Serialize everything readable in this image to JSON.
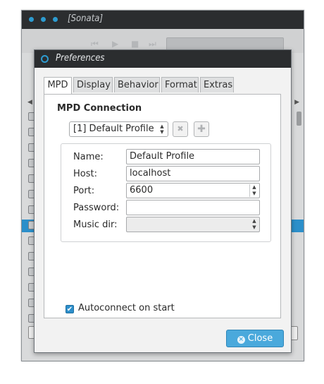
{
  "background_window": {
    "title": "[Sonata]",
    "titlebar_color": "#2b2d2f",
    "accent": "#2d9bd0"
  },
  "dialog": {
    "title": "Preferences",
    "tabs": [
      {
        "label": "MPD",
        "active": true
      },
      {
        "label": "Display",
        "active": false
      },
      {
        "label": "Behavior",
        "active": false
      },
      {
        "label": "Format",
        "active": false
      },
      {
        "label": "Extras",
        "active": false
      }
    ],
    "section_title": "MPD Connection",
    "profile_select": {
      "value": "[1] Default Profile"
    },
    "remove_profile_icon": "remove-icon",
    "add_profile_icon": "add-icon",
    "fields": {
      "name": {
        "label": "Name:",
        "value": "Default Profile"
      },
      "host": {
        "label": "Host:",
        "value": "localhost"
      },
      "port": {
        "label": "Port:",
        "value": "6600"
      },
      "password": {
        "label": "Password:",
        "value": ""
      },
      "music_dir": {
        "label": "Music dir:",
        "value": ""
      }
    },
    "autoconnect": {
      "label": "Autoconnect on start",
      "checked": true
    },
    "close_button": {
      "label": "Close",
      "icon": "close-icon"
    },
    "accent_color": "#4aa9dc"
  }
}
